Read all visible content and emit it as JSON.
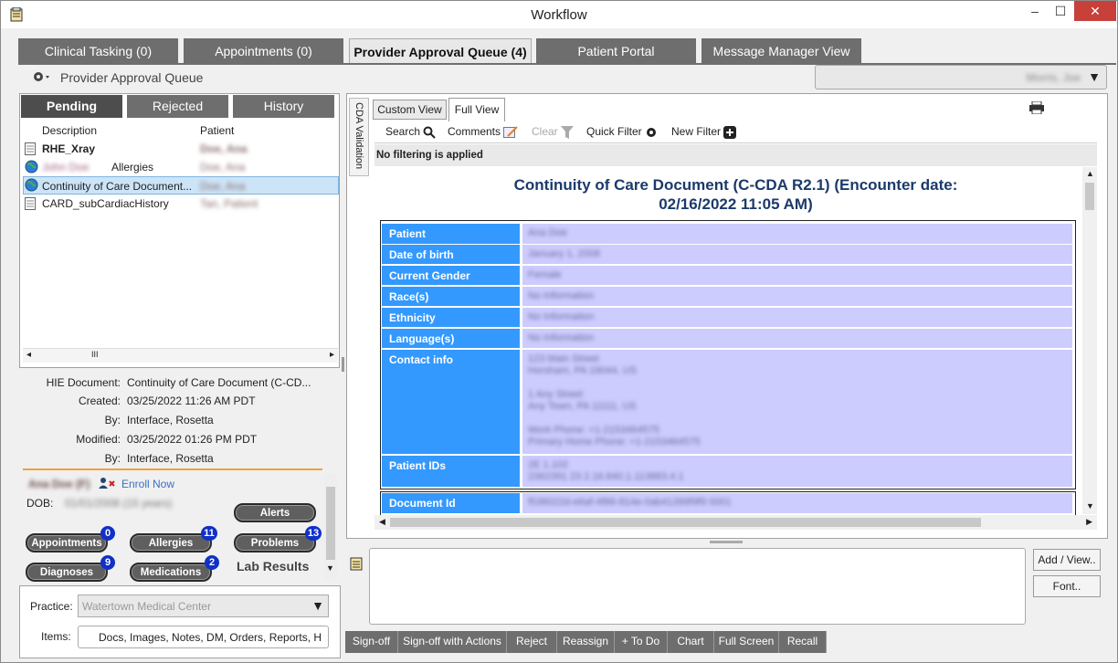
{
  "window": {
    "title": "Workflow",
    "minimize": "–",
    "maximize": "☐",
    "close": "✕"
  },
  "main_tabs": [
    {
      "label": "Clinical Tasking (0)"
    },
    {
      "label": "Appointments (0)"
    },
    {
      "label": "Provider Approval Queue (4)"
    },
    {
      "label": "Patient Portal"
    },
    {
      "label": "Message Manager View"
    }
  ],
  "toolbar": {
    "section_title": "Provider Approval Queue",
    "user_select": "Morris, Joe"
  },
  "queue_tabs": [
    "Pending",
    "Rejected",
    "History"
  ],
  "list": {
    "headers": [
      "Description",
      "Patient"
    ],
    "rows": [
      {
        "description": "RHE_Xray",
        "patient": "Doe, Ana",
        "bold": true
      },
      {
        "description": "John Doe Allergies",
        "blurred_prefix": "John Doe",
        "suffix": "Allergies",
        "patient": "Doe, Ana"
      },
      {
        "description": "Continuity of Care Document...",
        "patient": "Doe, Ana",
        "selected": true
      },
      {
        "description": "CARD_subCardiacHistory",
        "patient": "Tan, Patient"
      }
    ],
    "hscroll_label": "III"
  },
  "details": {
    "hie_label": "HIE Document:",
    "hie_value": "Continuity of Care Document (C-CD...",
    "created_label": "Created:",
    "created_value": "03/25/2022 11:26 AM PDT",
    "by_label": "By:",
    "by_value": "Interface, Rosetta",
    "modified_label": "Modified:",
    "modified_value": "03/25/2022 01:26 PM PDT",
    "by2_label": "By:",
    "by2_value": "Interface, Rosetta"
  },
  "patient_card": {
    "name": "Ana Doe (F)",
    "enroll": "Enroll Now",
    "dob_label": "DOB:",
    "dob_value": "01/01/2008 (15 years)",
    "alerts": "Alerts",
    "buttons": [
      {
        "label": "Appointments",
        "count": "0"
      },
      {
        "label": "Allergies",
        "count": "11"
      },
      {
        "label": "Problems",
        "count": "13"
      },
      {
        "label": "Diagnoses",
        "count": "9"
      },
      {
        "label": "Medications",
        "count": "2"
      }
    ],
    "lab_results": "Lab Results"
  },
  "bottom_left": {
    "practice_label": "Practice:",
    "practice_value": "Watertown Medical Center",
    "items_label": "Items:",
    "items_value": "Docs, Images, Notes, DM, Orders, Reports, H"
  },
  "viewer": {
    "side_tab": "CDA Validation",
    "tabs": [
      "Custom View",
      "Full View"
    ],
    "tools": {
      "search": "Search",
      "comments": "Comments",
      "clear": "Clear",
      "quick_filter": "Quick Filter",
      "new_filter": "New Filter"
    },
    "filter_status": "No filtering is applied",
    "doc_title_1": "Continuity of Care Document (C-CDA R2.1) (Encounter date:",
    "doc_title_2": "02/16/2022 11:05 AM)",
    "rows": [
      {
        "label": "Patient",
        "value": "Ana Doe"
      },
      {
        "label": "Date of birth",
        "value": "January 1, 2008"
      },
      {
        "label": "Current Gender",
        "value": "Female"
      },
      {
        "label": "Race(s)",
        "value": "No Information"
      },
      {
        "label": "Ethnicity",
        "value": "No Information"
      },
      {
        "label": "Language(s)",
        "value": "No Information"
      },
      {
        "label": "Contact info",
        "lines": [
          "123 Main Street",
          "Horsham, PA 19044, US",
          "",
          "1 Any Street",
          "Any Town, PA 11111, US",
          "",
          "Work Phone: +1-2153464575",
          "Primary Home Phone: +1-2153464575"
        ]
      },
      {
        "label": "Patient IDs",
        "lines": [
          "2E 1.102",
          "2362391 23 2.16.840.1.113883.4.1"
        ]
      },
      {
        "label": "Document Id",
        "value": "f538022d-e6af-4f86-814e-0ab41399f9f9 0001"
      }
    ]
  },
  "comments": {
    "add_view": "Add / View..",
    "font": "Font.."
  },
  "actions": [
    "Sign-off",
    "Sign-off with Actions",
    "Reject",
    "Reassign",
    "+ To Do",
    "Chart",
    "Full Screen",
    "Recall"
  ]
}
